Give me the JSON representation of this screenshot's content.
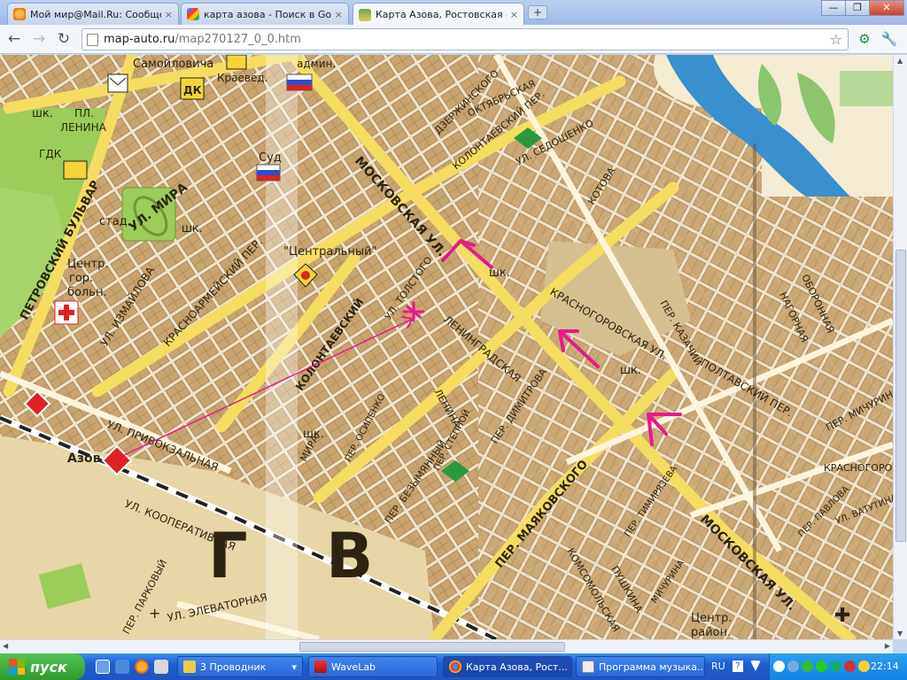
{
  "browser": {
    "tabs": [
      {
        "label": "Мой мир@Mail.Ru: Сообщест",
        "close": "×"
      },
      {
        "label": "карта азова - Поиск в Google",
        "close": "×"
      },
      {
        "label": "Карта Азова, Ростовская об",
        "close": "×"
      }
    ],
    "new_tab": "+",
    "window_controls": {
      "minimize": "—",
      "maximize": "❐",
      "close": "✕"
    },
    "nav": {
      "back": "←",
      "forward": "→",
      "reload": "↻"
    },
    "url_host": "map-auto.ru",
    "url_path": "/map270127_0_0.htm",
    "bookmark_icon": "star-icon",
    "tools": {
      "ext1": "⚙",
      "wrench": "🔧"
    }
  },
  "map": {
    "streets": {
      "moskovskaya": "МОСКОВСКАЯ УЛ.",
      "moskovskaya2": "МОСКОВСКАЯ УЛ.",
      "mayakovskogo": "ПЕР. МАЯКОВСКОГО",
      "kooperativnaya": "УЛ. КООПЕРАТИВНАЯ",
      "privokzalnaya": "УЛ. ПРИВОКЗАЛЬНАЯ",
      "mira": "УЛ. МИРА",
      "izmailova": "УЛ. ИЗМАЙЛОВА",
      "petrovsky": "ПЕТРОВСКИЙ БУЛЬВАР",
      "kolontaevsky": "КОЛОНТАЕВСКИЙ",
      "krasnoarmeisky": "КРАСНОАРМЕЙСКИЙ ПЕР.",
      "leningradskaya": "ЛЕНИНГРАДСКАЯ",
      "krasnogorovskaya": "КРАСНОГОРОВСКАЯ УЛ.",
      "poltavsky": "ПОЛТАВСКИЙ ПЕР.",
      "michurina": "ПЕР. МИЧУРИНА",
      "elevatornaya": "УЛ. ЭЛЕВАТОРНАЯ",
      "komsomolskaya": "КОМСОМОЛЬСКАЯ",
      "pushkina": "ПУШКИНА",
      "tolstogo": "УЛ. ТОЛСТОГО",
      "dimitrova": "ПЕР. ДИМИТРОВА",
      "bezymyanny": "ПЕР. БЕЗЫМЯННЫЙ",
      "oboronnaya": "ОБОРОННАЯ",
      "nagornaya": "НАГОРНАЯ",
      "kazachy": "ПЕР. КАЗАЧИЙ",
      "parkovy": "ПЕР. ПАРКОВЫЙ",
      "lenina_ul": "ЛЕНИНА",
      "kotova": "КОТОВА",
      "sedoshenko": "УЛ. СЕДОШЕНКО",
      "kolontaevsky_per": "КОЛОНТАЕВСКИЙ ПЕР.",
      "mira_per": "МИРА",
      "dzerzhinskogo": "ДЗЕРЖИНСКОГО",
      "oktyabrskaya": "ОКТЯБРЬСКАЯ",
      "samoilovicha": "Самойловича",
      "kraeved": "Краевед.",
      "admin": "админ.",
      "sud": "Суд",
      "central": "\"Центральный\"",
      "center_hosp": "Центр.",
      "gor": "гор.",
      "bolni": "больн.",
      "stad": "стад.",
      "shk1": "шк.",
      "shk2": "шк.",
      "shk3": "шк.",
      "shk4": "шк.",
      "shk5": "шк.",
      "pl_lenina_1": "ПЛ.",
      "pl_lenina_2": "ЛЕНИНА",
      "gdk": "ГДК",
      "dk": "ДК",
      "azov": "Азов",
      "center_raion": "Центр.",
      "raion": "район.",
      "zone_g": "Г",
      "zone_v": "В",
      "krasnogoro": "КРАСНОГОРО",
      "vatutina": "УЛ. ВАТУТИНА",
      "pavlova": "ПЕР. ПАВЛОВА",
      "timiryazeva": "ПЕР. ТИМИРЯЗЕВА",
      "michurina_ul": "МИЧУРИНА",
      "stepnoi": "ПЕР. СТЕПНОЙ",
      "osipenko": "ПЕР. ОСИПЕНКО"
    }
  },
  "taskbar": {
    "start": "пуск",
    "tasks": [
      {
        "label": "3 Проводник",
        "arrow": "▾"
      },
      {
        "label": "WaveLab"
      },
      {
        "label": "Карта Азова, Рост..."
      },
      {
        "label": "Программа музыка..."
      }
    ],
    "lang": "RU",
    "help": "?",
    "clock": "22:14"
  }
}
